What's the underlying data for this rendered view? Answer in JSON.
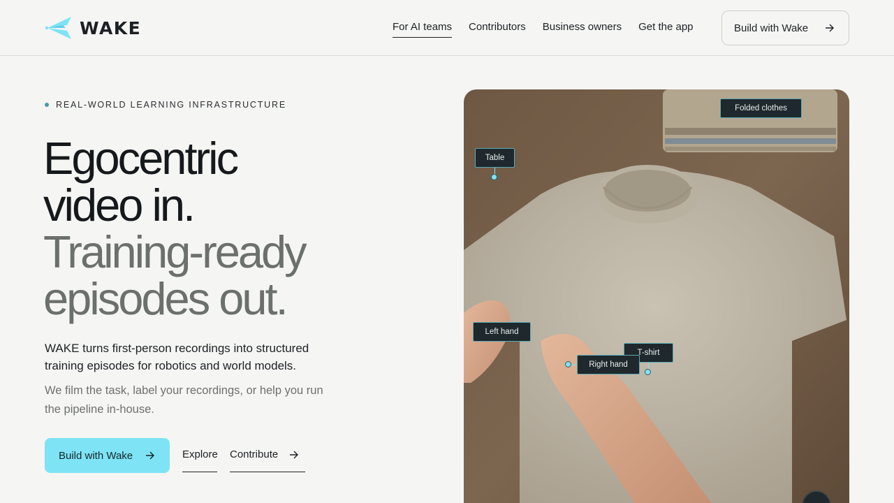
{
  "brand": {
    "name": "WAKE",
    "accent": "#7de3f5"
  },
  "nav": {
    "items": [
      {
        "label": "For AI teams",
        "active": true
      },
      {
        "label": "Contributors",
        "active": false
      },
      {
        "label": "Business owners",
        "active": false
      },
      {
        "label": "Get the app",
        "active": false
      }
    ],
    "cta_label": "Build with Wake"
  },
  "hero": {
    "eyebrow": "REAL-WORLD LEARNING INFRASTRUCTURE",
    "headline_line1": "Egocentric",
    "headline_line2": "video in.",
    "headline_line3": "Training-ready",
    "headline_line4": "episodes out.",
    "lead": "WAKE turns first-person recordings into structured training episodes for robotics and world models.",
    "sub": "We film the task, label your recordings, or help you run the pipeline in-house.",
    "primary_cta": "Build with Wake",
    "explore_label": "Explore",
    "contribute_label": "Contribute"
  },
  "media": {
    "labels": {
      "folded_clothes": "Folded clothes",
      "table": "Table",
      "left_hand": "Left hand",
      "t_shirt": "T-shirt",
      "right_hand": "Right hand"
    }
  },
  "icons": [
    "logo-mark-icon",
    "arrow-right-icon"
  ]
}
